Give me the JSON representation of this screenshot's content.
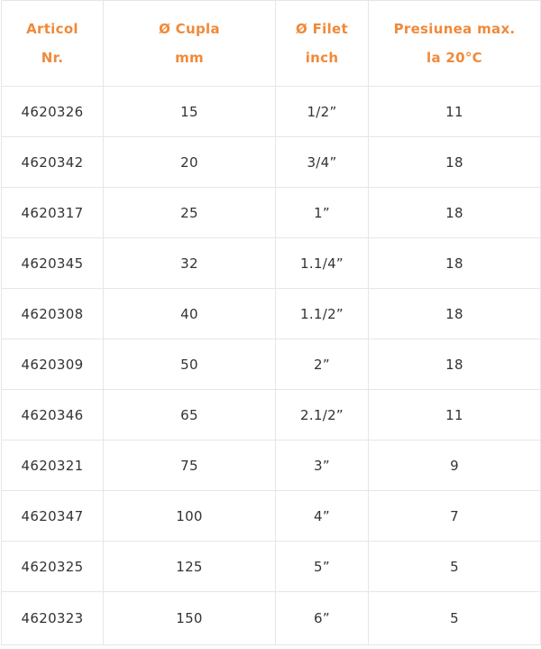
{
  "colors": {
    "header_text": "#f08a3a",
    "body_text": "#333333",
    "border": "#e6e6e6"
  },
  "headers": [
    {
      "line1": "Articol",
      "line2": "Nr."
    },
    {
      "line1": "Ø Cupla",
      "line2": "mm"
    },
    {
      "line1": "Ø Filet",
      "line2": "inch"
    },
    {
      "line1": "Presiunea max.",
      "line2": "la 20°C"
    }
  ],
  "rows": [
    [
      "4620326",
      "15",
      "1/2”",
      "11"
    ],
    [
      "4620342",
      "20",
      "3/4”",
      "18"
    ],
    [
      "4620317",
      "25",
      "1”",
      "18"
    ],
    [
      "4620345",
      "32",
      "1.1/4”",
      "18"
    ],
    [
      "4620308",
      "40",
      "1.1/2”",
      "18"
    ],
    [
      "4620309",
      "50",
      "2”",
      "18"
    ],
    [
      "4620346",
      "65",
      "2.1/2”",
      "11"
    ],
    [
      "4620321",
      "75",
      "3”",
      "9"
    ],
    [
      "4620347",
      "100",
      "4”",
      "7"
    ],
    [
      "4620325",
      "125",
      "5”",
      "5"
    ],
    [
      "4620323",
      "150",
      "6”",
      "5"
    ]
  ]
}
